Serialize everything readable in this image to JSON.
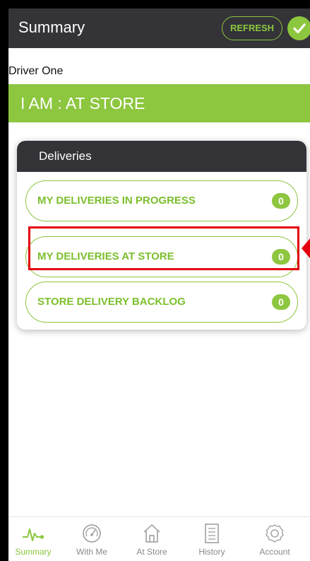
{
  "header": {
    "title": "Summary",
    "refresh_label": "REFRESH"
  },
  "driver_name": "Driver One",
  "status_text": "I AM : AT STORE",
  "deliveries": {
    "title": "Deliveries",
    "items": [
      {
        "label": "MY DELIVERIES IN PROGRESS",
        "count": "0"
      },
      {
        "label": "MY DELIVERIES AT STORE",
        "count": "0"
      },
      {
        "label": "STORE DELIVERY BACKLOG",
        "count": "0"
      }
    ]
  },
  "tabs": [
    {
      "label": "Summary",
      "icon": "pulse-icon",
      "active": true
    },
    {
      "label": "With Me",
      "icon": "speedometer-icon",
      "active": false
    },
    {
      "label": "At Store",
      "icon": "home-icon",
      "active": false
    },
    {
      "label": "History",
      "icon": "document-icon",
      "active": false
    },
    {
      "label": "Account",
      "icon": "gear-icon",
      "active": false
    }
  ],
  "colors": {
    "accent": "#8dc63f",
    "header": "#333338",
    "highlight": "#e3000f"
  }
}
